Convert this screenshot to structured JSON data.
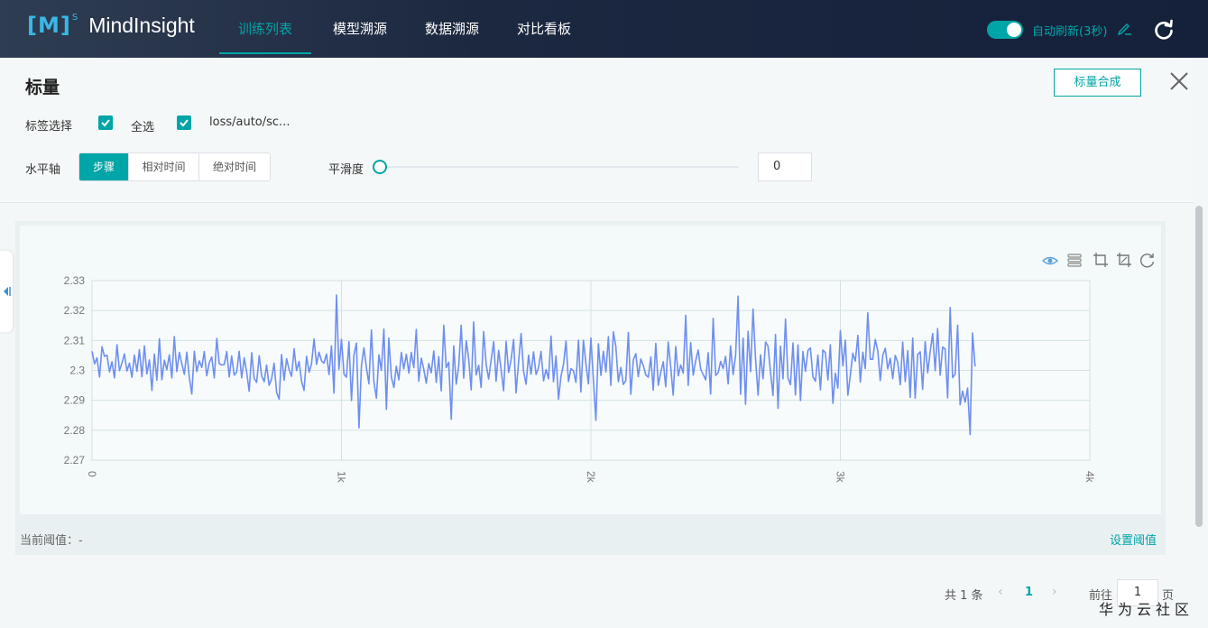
{
  "app": {
    "logo_mark": "[M]",
    "logo_sup": "S",
    "logo_text": "MindInsight"
  },
  "nav": [
    {
      "label": "训练列表",
      "active": true
    },
    {
      "label": "模型溯源",
      "active": false
    },
    {
      "label": "数据溯源",
      "active": false
    },
    {
      "label": "对比看板",
      "active": false
    }
  ],
  "auto_refresh": {
    "label": "自动刷新(3秒)",
    "enabled": true
  },
  "page": {
    "title": "标量",
    "compose_button": "标量合成"
  },
  "tags": {
    "label": "标签选择",
    "select_all": {
      "label": "全选",
      "checked": true
    },
    "items": [
      {
        "label": "loss/auto/sc...",
        "checked": true
      }
    ]
  },
  "xaxis": {
    "label": "水平轴",
    "options": [
      {
        "label": "步骤",
        "active": true
      },
      {
        "label": "相对时间",
        "active": false
      },
      {
        "label": "绝对时间",
        "active": false
      }
    ]
  },
  "smoothing": {
    "label": "平滑度",
    "value": "0",
    "slider_fraction": 0
  },
  "chart_footer": {
    "threshold_label": "当前阈值：-",
    "set_threshold": "设置阈值"
  },
  "toolbar_icons": [
    "eye-icon",
    "layers-icon",
    "crop-icon",
    "crop-reset-icon",
    "restore-icon"
  ],
  "pagination": {
    "total": "共 1 条",
    "current": "1",
    "goto_label": "前往",
    "goto_value": "1",
    "page_label": "页"
  },
  "watermark": "华为云社区",
  "colors": {
    "accent": "#00a5a7",
    "line": "#6f8ff0",
    "nav_bg": "#1c2840"
  },
  "chart_data": {
    "type": "line",
    "xlim": [
      0,
      4000
    ],
    "ylim": [
      2.27,
      2.33
    ],
    "xticks": [
      "0",
      "1k",
      "2k",
      "3k",
      "4k"
    ],
    "yticks": [
      "2.33",
      "2.32",
      "2.31",
      "2.3",
      "2.29",
      "2.28",
      "2.27"
    ],
    "ytick_values": [
      2.33,
      2.32,
      2.31,
      2.3,
      2.29,
      2.28,
      2.27
    ],
    "xtick_values": [
      0,
      1000,
      2000,
      3000,
      4000
    ],
    "grid": true,
    "series": [
      {
        "x_start": 0,
        "x_step": 10,
        "values": [
          2.3064,
          2.3022,
          2.3042,
          2.2978,
          2.3079,
          2.3047,
          2.3051,
          2.2995,
          2.3029,
          2.2975,
          2.3086,
          2.2999,
          2.3025,
          2.3055,
          2.2998,
          2.3024,
          2.2977,
          2.3051,
          2.2997,
          2.3069,
          2.2979,
          2.3082,
          2.2988,
          2.3035,
          2.2933,
          2.3054,
          2.2967,
          2.3106,
          2.2969,
          2.3034,
          2.3002,
          2.3052,
          2.2975,
          2.3113,
          2.2996,
          2.306,
          2.3023,
          2.2987,
          2.3061,
          2.2977,
          2.2921,
          2.3064,
          2.2996,
          2.3032,
          2.301,
          2.3063,
          2.2982,
          2.3026,
          2.3045,
          2.2975,
          2.3107,
          2.3023,
          2.3018,
          2.3019,
          2.3063,
          2.2978,
          2.3048,
          2.2984,
          2.2995,
          2.3064,
          2.2975,
          2.3042,
          2.2995,
          2.293,
          2.3059,
          2.2973,
          2.296,
          2.3049,
          2.2982,
          2.2962,
          2.3018,
          2.295,
          2.2972,
          2.3024,
          2.2926,
          2.2904,
          2.3053,
          2.2967,
          2.3039,
          2.3003,
          2.298,
          2.3072,
          2.2999,
          2.303,
          2.2963,
          2.2933,
          2.3047,
          2.2994,
          2.3022,
          2.3105,
          2.302,
          2.3061,
          2.3032,
          2.3024,
          2.3055,
          2.2986,
          2.3082,
          2.2924,
          2.3252,
          2.3004,
          2.3104,
          2.2987,
          2.2977,
          2.3096,
          2.2899,
          2.3051,
          2.3091,
          2.2808,
          2.3015,
          2.3075,
          2.3008,
          2.2955,
          2.3135,
          2.2963,
          2.2907,
          2.3052,
          2.3,
          2.3138,
          2.287,
          2.3108,
          2.2978,
          2.2943,
          2.3014,
          2.2968,
          2.306,
          2.3005,
          2.3054,
          2.2991,
          2.306,
          2.3009,
          2.3137,
          2.2964,
          2.3041,
          2.3004,
          2.2957,
          2.3023,
          2.2992,
          2.3065,
          2.296,
          2.3046,
          2.2932,
          2.3151,
          2.3009,
          2.3027,
          2.2837,
          2.3082,
          2.2954,
          2.3015,
          2.3151,
          2.2974,
          2.3099,
          2.3039,
          2.2935,
          2.3162,
          2.2985,
          2.3017,
          2.2943,
          2.313,
          2.302,
          2.2971,
          2.3034,
          2.3096,
          2.2964,
          2.3067,
          2.3001,
          2.2932,
          2.3097,
          2.2993,
          2.3036,
          2.3103,
          2.2925,
          2.3028,
          2.3123,
          2.2998,
          2.2954,
          2.3051,
          2.2987,
          2.3062,
          2.2986,
          2.3009,
          2.3063,
          2.2965,
          2.3003,
          2.2972,
          2.3115,
          2.2962,
          2.3048,
          2.2904,
          2.298,
          2.302,
          2.3098,
          2.2963,
          2.3006,
          2.2999,
          2.296,
          2.3101,
          2.2928,
          2.3101,
          2.3021,
          2.2955,
          2.3108,
          2.2965,
          2.2833,
          2.3089,
          2.2983,
          2.3064,
          2.2995,
          2.3113,
          2.295,
          2.3129,
          2.308,
          2.2962,
          2.301,
          2.2953,
          2.2966,
          2.3127,
          2.292,
          2.3035,
          2.3056,
          2.2979,
          2.3038,
          2.3016,
          2.2985,
          2.2977,
          2.3045,
          2.2934,
          2.309,
          2.295,
          2.2994,
          2.3029,
          2.2945,
          2.3095,
          2.3011,
          2.2917,
          2.308,
          2.2982,
          2.3018,
          2.2991,
          2.3184,
          2.295,
          2.3093,
          2.2984,
          2.3032,
          2.3068,
          2.3004,
          2.2987,
          2.2968,
          2.3059,
          2.2921,
          2.3174,
          2.2983,
          2.2992,
          2.303,
          2.3006,
          2.3047,
          2.2955,
          2.3082,
          2.2986,
          2.3051,
          2.3248,
          2.292,
          2.3108,
          2.2887,
          2.3131,
          2.2996,
          2.3205,
          2.3038,
          2.2917,
          2.3052,
          2.2972,
          2.3095,
          2.3081,
          2.2994,
          2.2916,
          2.312,
          2.2873,
          2.3081,
          2.2972,
          2.3172,
          2.2975,
          2.2952,
          2.3092,
          2.2918,
          2.3085,
          2.2899,
          2.3063,
          2.2997,
          2.3067,
          2.3075,
          2.2978,
          2.2964,
          2.3051,
          2.2935,
          2.3068,
          2.3059,
          2.2968,
          2.3086,
          2.289,
          2.2991,
          2.2941,
          2.3133,
          2.3015,
          2.3101,
          2.2917,
          2.2986,
          2.3057,
          2.3031,
          2.3117,
          2.2961,
          2.3061,
          2.3006,
          2.3193,
          2.3037,
          2.3037,
          2.3103,
          2.3065,
          2.2966,
          2.305,
          2.3074,
          2.3005,
          2.304,
          2.2972,
          2.305,
          2.3027,
          2.2952,
          2.3095,
          2.2963,
          2.3066,
          2.291,
          2.3108,
          2.2907,
          2.3053,
          2.3062,
          2.2937,
          2.3096,
          2.2992,
          2.3061,
          2.3123,
          2.2999,
          2.314,
          2.2984,
          2.3078,
          2.3072,
          2.2908,
          2.321,
          2.2976,
          2.2987,
          2.3151,
          2.2885,
          2.2931,
          2.2894,
          2.2941,
          2.2786,
          2.3125,
          2.3013
        ]
      }
    ]
  }
}
